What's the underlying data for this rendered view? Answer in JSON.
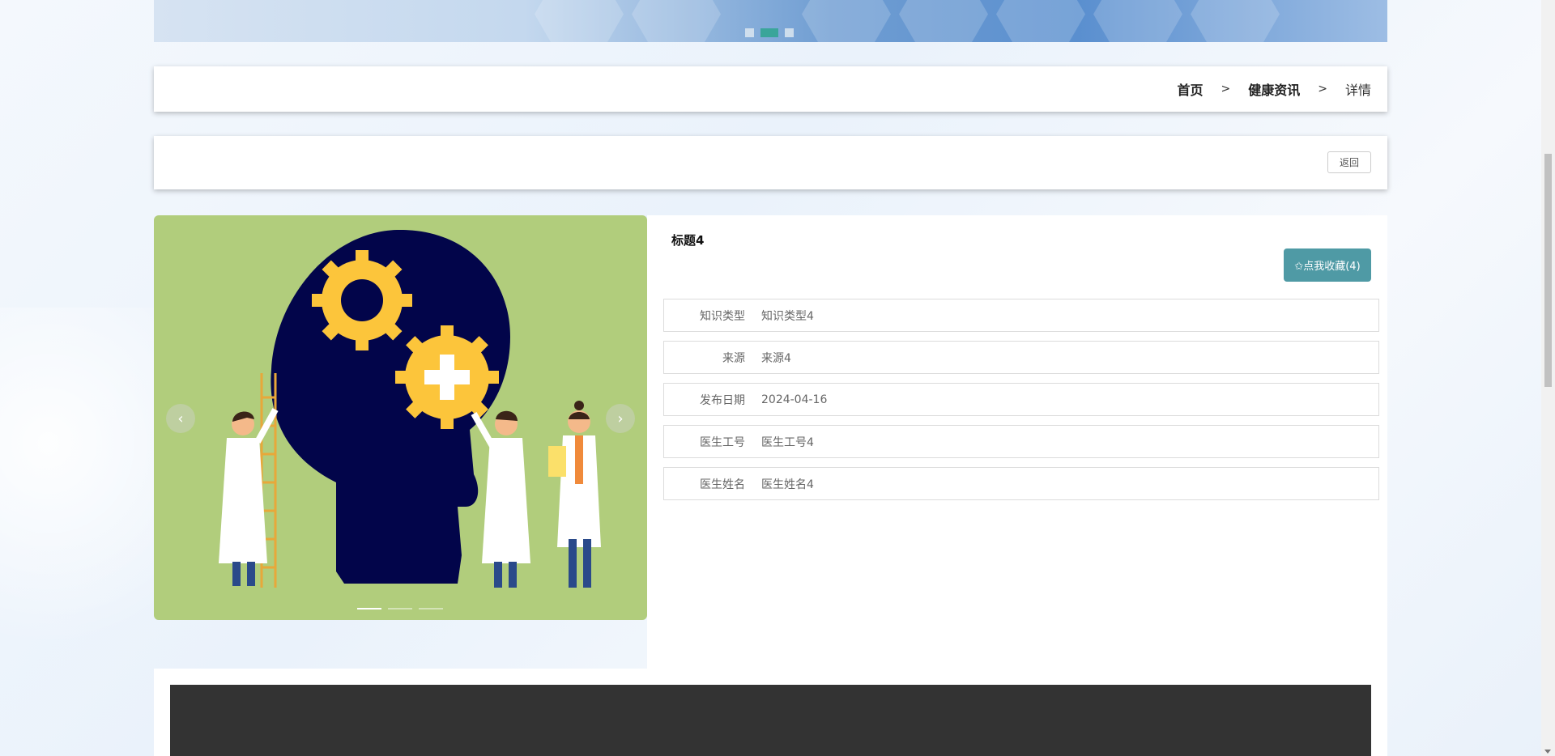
{
  "banner": {
    "slide_count": 3,
    "active_slide": 2
  },
  "breadcrumb": {
    "home": "首页",
    "separator": ">",
    "section": "健康资讯",
    "current": "详情"
  },
  "actions": {
    "back_label": "返回"
  },
  "carousel": {
    "prev_label": "‹",
    "next_label": "›",
    "slide_count": 3,
    "active_slide": 1,
    "bg_color": "#b1cd7c"
  },
  "detail": {
    "title": "标题4",
    "favorite_label": "✩点我收藏(4)",
    "accent_color": "#4f9aa5",
    "fields": [
      {
        "label": "知识类型",
        "value": "知识类型4"
      },
      {
        "label": "来源",
        "value": "来源4"
      },
      {
        "label": "发布日期",
        "value": "2024-04-16"
      },
      {
        "label": "医生工号",
        "value": "医生工号4"
      },
      {
        "label": "医生姓名",
        "value": "医生姓名4"
      }
    ]
  }
}
